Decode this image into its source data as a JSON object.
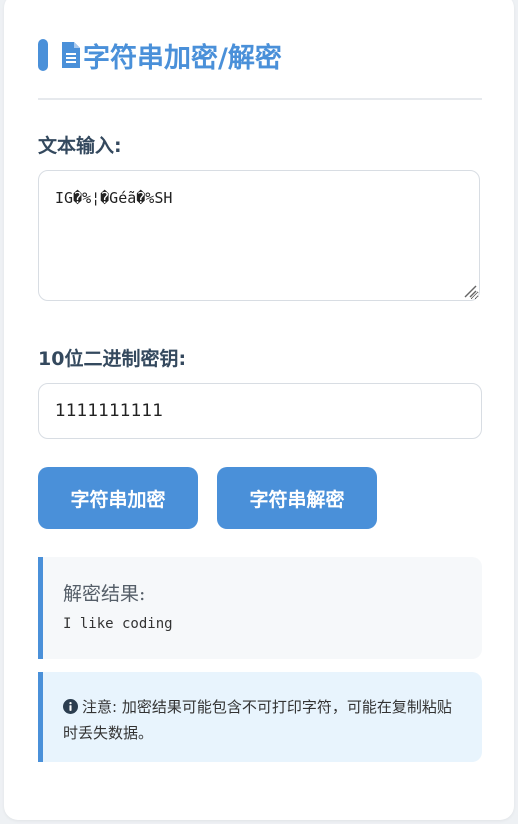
{
  "header": {
    "title": "字符串加密/解密",
    "icon": "file-text-icon",
    "accent_color": "#4a90d9"
  },
  "text_input": {
    "label": "文本输入:",
    "value": "IG�%¦�Géã�%SH"
  },
  "key_input": {
    "label": "10位二进制密钥:",
    "value": "1111111111"
  },
  "buttons": {
    "encrypt_label": "字符串加密",
    "decrypt_label": "字符串解密",
    "color": "#4a90d9"
  },
  "result": {
    "title": "解密结果:",
    "text": "I like coding"
  },
  "note": {
    "icon": "info-circle-icon",
    "text": "注意: 加密结果可能包含不可打印字符，可能在复制粘贴时丢失数据。"
  }
}
